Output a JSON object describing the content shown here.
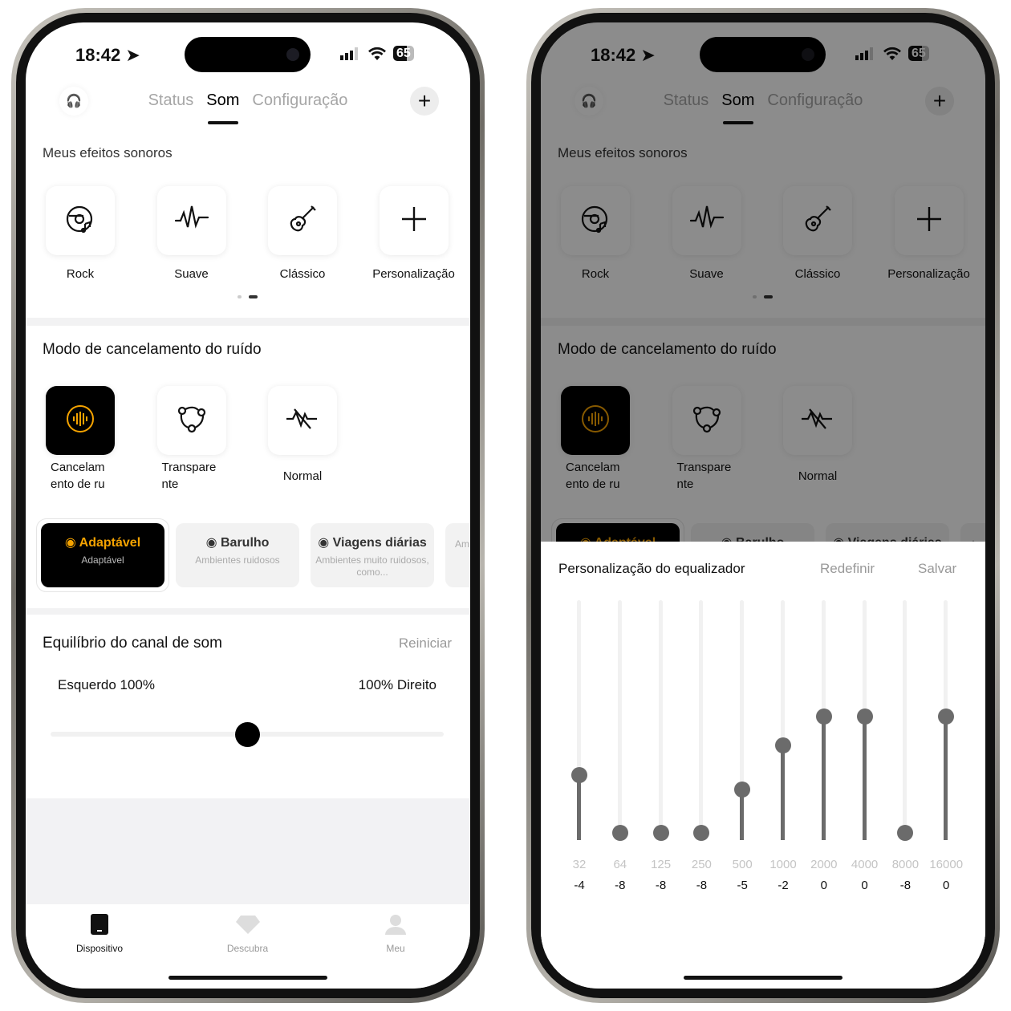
{
  "status_bar": {
    "time": "18:42",
    "battery": "65"
  },
  "header": {
    "tabs": [
      {
        "label": "Status"
      },
      {
        "label": "Som",
        "active": true
      },
      {
        "label": "Configuração"
      }
    ],
    "add_label": "+"
  },
  "sound_effects": {
    "title": "Meus efeitos sonoros",
    "items": [
      {
        "label": "Rock",
        "icon": "disc-music-icon"
      },
      {
        "label": "Suave",
        "icon": "wave-icon"
      },
      {
        "label": "Clássico",
        "icon": "guitar-icon"
      },
      {
        "label": "Personalização",
        "icon": "plus-icon"
      }
    ],
    "page": 2,
    "pages": 2
  },
  "noise_mode": {
    "title": "Modo de cancelamento do ruído",
    "items": [
      {
        "label": "Cancelam ento de ru",
        "selected": true,
        "icon": "anc-icon"
      },
      {
        "label": "Transpare nte",
        "icon": "transparency-icon"
      },
      {
        "label": "Normal",
        "icon": "normal-icon"
      }
    ],
    "scenes": [
      {
        "title": "Adaptável",
        "subtitle": "Adaptável",
        "selected": true
      },
      {
        "title": "Barulho",
        "subtitle": "Ambientes ruidosos"
      },
      {
        "title": "Viagens diárias",
        "subtitle": "Ambientes muito ruidosos, como..."
      },
      {
        "title": "",
        "subtitle": "Am co"
      }
    ]
  },
  "balance": {
    "title": "Equilíbrio do canal de som",
    "reset": "Reiniciar",
    "left": "Esquerdo 100%",
    "right": "100% Direito",
    "value": 50
  },
  "tabbar": {
    "items": [
      {
        "label": "Dispositivo",
        "active": true
      },
      {
        "label": "Descubra"
      },
      {
        "label": "Meu"
      }
    ]
  },
  "equalizer": {
    "title": "Personalização do equalizador",
    "reset": "Redefinir",
    "save": "Salvar",
    "range": [
      -8,
      8
    ],
    "bands": [
      {
        "freq": "32",
        "value": -4
      },
      {
        "freq": "64",
        "value": -8
      },
      {
        "freq": "125",
        "value": -8
      },
      {
        "freq": "250",
        "value": -8
      },
      {
        "freq": "500",
        "value": -5
      },
      {
        "freq": "1000",
        "value": -2
      },
      {
        "freq": "2000",
        "value": 0
      },
      {
        "freq": "4000",
        "value": 0
      },
      {
        "freq": "8000",
        "value": -8
      },
      {
        "freq": "16000",
        "value": 0
      }
    ]
  },
  "colors": {
    "accent": "#f5a300",
    "selected_bg": "#000000"
  }
}
